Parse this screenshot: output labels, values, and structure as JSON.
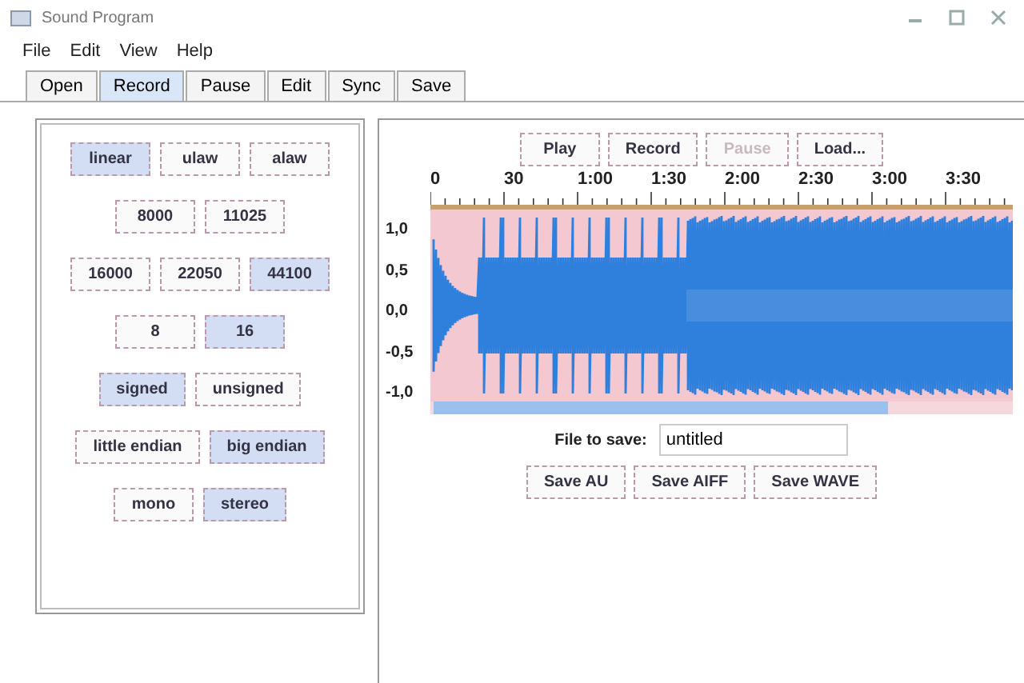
{
  "window": {
    "title": "Sound Program"
  },
  "menu": [
    "File",
    "Edit",
    "View",
    "Help"
  ],
  "tabs": [
    {
      "label": "Open",
      "selected": false
    },
    {
      "label": "Record",
      "selected": true
    },
    {
      "label": "Pause",
      "selected": false
    },
    {
      "label": "Edit",
      "selected": false
    },
    {
      "label": "Sync",
      "selected": false
    },
    {
      "label": "Save",
      "selected": false
    }
  ],
  "format_rows": [
    [
      {
        "label": "linear",
        "selected": true
      },
      {
        "label": "ulaw",
        "selected": false
      },
      {
        "label": "alaw",
        "selected": false
      }
    ],
    [
      {
        "label": "8000",
        "selected": false
      },
      {
        "label": "11025",
        "selected": false
      }
    ],
    [
      {
        "label": "16000",
        "selected": false
      },
      {
        "label": "22050",
        "selected": false
      },
      {
        "label": "44100",
        "selected": true
      }
    ],
    [
      {
        "label": "8",
        "selected": false
      },
      {
        "label": "16",
        "selected": true
      }
    ],
    [
      {
        "label": "signed",
        "selected": true
      },
      {
        "label": "unsigned",
        "selected": false
      }
    ],
    [
      {
        "label": "little endian",
        "selected": false
      },
      {
        "label": "big endian",
        "selected": true
      }
    ],
    [
      {
        "label": "mono",
        "selected": false
      },
      {
        "label": "stereo",
        "selected": true
      }
    ]
  ],
  "controls": [
    {
      "label": "Play",
      "disabled": false
    },
    {
      "label": "Record",
      "disabled": false
    },
    {
      "label": "Pause",
      "disabled": true
    },
    {
      "label": "Load...",
      "disabled": false
    }
  ],
  "ruler_labels": [
    "0",
    "30",
    "1:00",
    "1:30",
    "2:00",
    "2:30",
    "3:00",
    "3:30"
  ],
  "amplitude_labels": [
    "1,0",
    "0,5",
    "0,0",
    "-0,5",
    "-1,0"
  ],
  "file_to_save": {
    "label": "File to save:",
    "value": "untitled"
  },
  "save_buttons": [
    "Save AU",
    "Save AIFF",
    "Save WAVE"
  ]
}
